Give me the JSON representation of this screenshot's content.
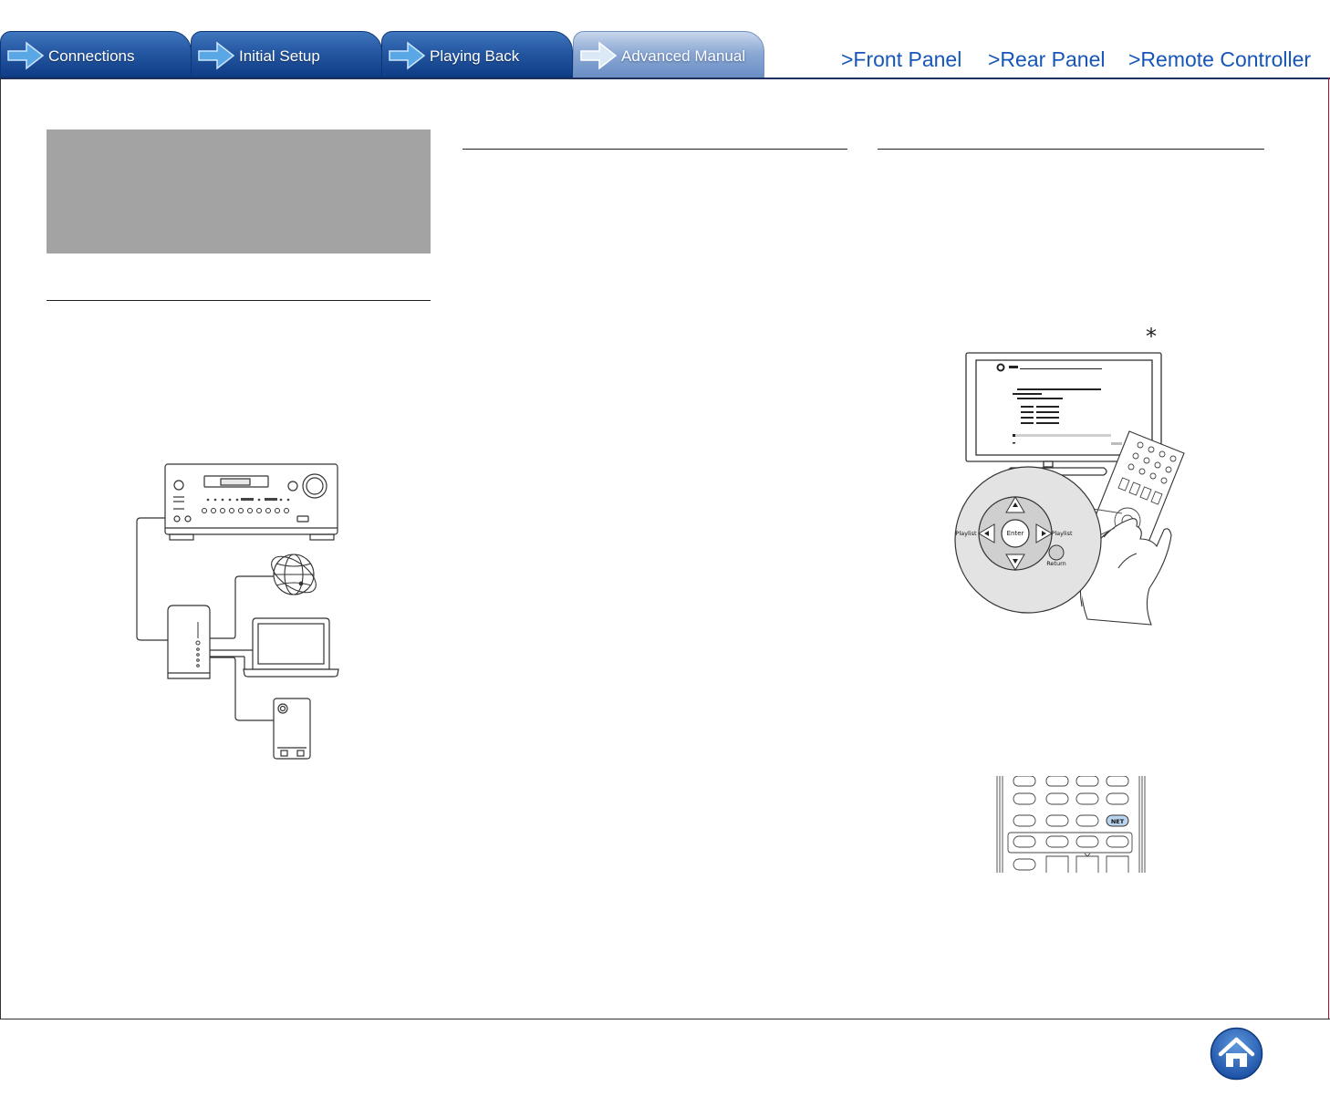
{
  "tabs": [
    {
      "label": "Connections",
      "active": false
    },
    {
      "label": "Initial Setup",
      "active": false
    },
    {
      "label": "Playing Back",
      "active": false
    },
    {
      "label": "Advanced Manual",
      "active": true
    }
  ],
  "nav_links": {
    "front_panel": ">Front Panel",
    "rear_panel": ">Rear Panel",
    "remote_controller": ">Remote Controller"
  },
  "remote_illustration": {
    "asterisk": "*",
    "left_button": "Playlist",
    "right_button": "Playlist",
    "center_button": "Enter",
    "return_button": "Return",
    "net_button": "NET"
  },
  "colors": {
    "tab_blue": "#2557a2",
    "tab_active": "#8eaad4",
    "link_blue": "#1656b9",
    "frame_red": "#b50e2e",
    "gray_box": "#a2a3a2",
    "home_button": "#2b67c2"
  },
  "icons": {
    "tab_arrow": "arrow-right-icon",
    "home": "home-icon"
  }
}
